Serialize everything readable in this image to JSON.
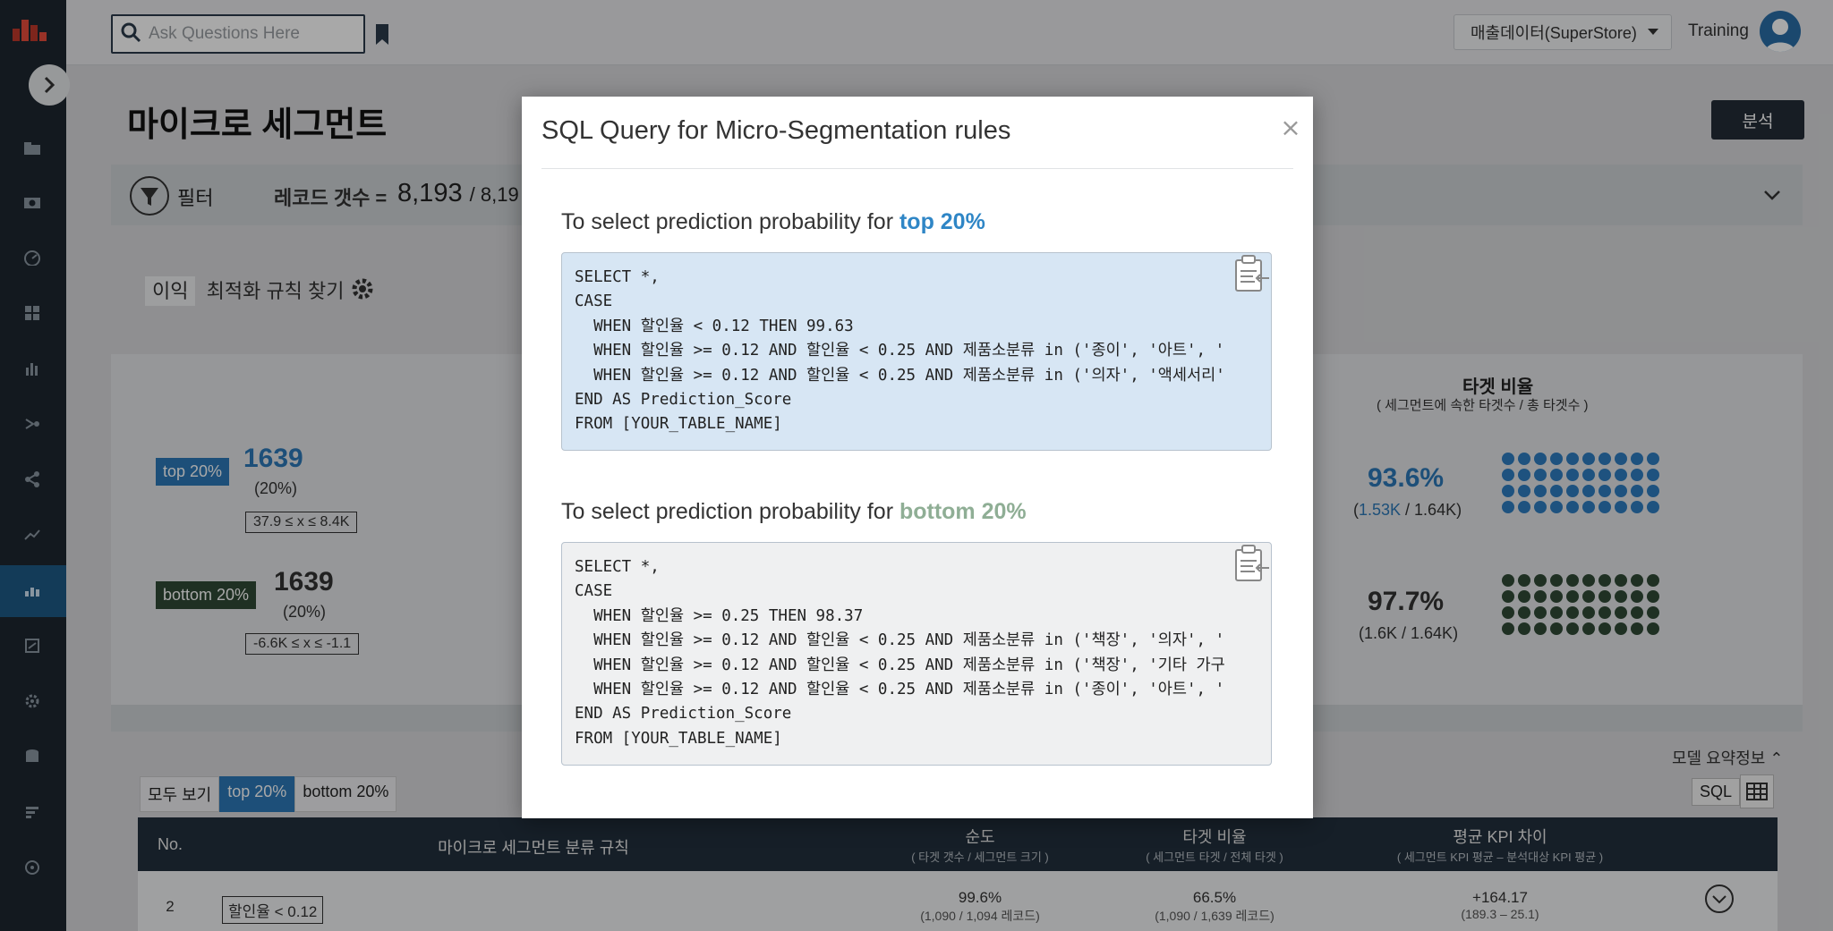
{
  "app": {
    "search_placeholder": "Ask Questions Here",
    "dataset": "매출데이터(SuperStore)",
    "user": "Training"
  },
  "page": {
    "title": "마이크로 세그먼트",
    "analyze_button": "분석",
    "filter_label": "필터",
    "record_label": "레코드 갯수 =",
    "record_count": "8,193",
    "record_total": "/ 8,19",
    "target_kpi": "이익",
    "optimize_label": "최적화 규칙 찾기"
  },
  "segments": {
    "top": {
      "tag": "top 20%",
      "count": "1639",
      "pct": "(20%)",
      "range": "37.9   ≤ x ≤  8.4K"
    },
    "bottom": {
      "tag": "bottom 20%",
      "count": "1639",
      "pct": "(20%)",
      "range": "-6.6K  ≤ x ≤   -1.1"
    }
  },
  "target_ratio": {
    "title": "타겟 비율",
    "subtitle": "( 세그먼트에 속한 타겟수 / 총 타겟수 )",
    "top_pct": "93.6%",
    "top_detail_a": "1.53K",
    "top_detail_b": " / 1.64K)",
    "top_detail_open": "(",
    "bottom_pct": "97.7%",
    "bottom_detail": "(1.6K / 1.64K)"
  },
  "table": {
    "model_summary": "모델 요약정보",
    "tabs": [
      "모두 보기",
      "top 20%",
      "bottom 20%"
    ],
    "sql_button": "SQL",
    "headers": {
      "no": "No.",
      "rule": "마이크로 세그먼트 분류 규칙",
      "purity": "순도",
      "purity_sub": "( 타겟 갯수 / 세그먼트 크기 )",
      "target_ratio": "타겟 비율",
      "target_ratio_sub": "( 세그먼트 타겟 / 전체 타겟 )",
      "kpi": "평균 KPI 차이",
      "kpi_sub": "( 세그먼트 KPI 평균 – 분석대상 KPI 평균 )"
    },
    "rows": [
      {
        "no": "2",
        "rule": "할인율 < 0.12",
        "purity": "99.6%",
        "purity_sub": "(1,090 / 1,094 레코드)",
        "ratio": "66.5%",
        "ratio_sub": "(1,090 / 1,639 레코드)",
        "kpi": "+164.17",
        "kpi_sub": "(189.3 – 25.1)"
      }
    ]
  },
  "modal": {
    "title": "SQL Query for Micro-Segmentation rules",
    "close": "×",
    "top_section_prefix": "To select prediction probability for ",
    "top_section_highlight": "top 20%",
    "bottom_section_prefix": "To select prediction probability for ",
    "bottom_section_highlight": "bottom 20%",
    "top_sql": "SELECT *,\nCASE\n  WHEN 할인율 < 0.12 THEN 99.63\n  WHEN 할인율 >= 0.12 AND 할인율 < 0.25 AND 제품소분류 in ('종이', '아트', '\n  WHEN 할인율 >= 0.12 AND 할인율 < 0.25 AND 제품소분류 in ('의자', '액세서리'\nEND AS Prediction_Score\nFROM [YOUR_TABLE_NAME]",
    "bottom_sql": "SELECT *,\nCASE\n  WHEN 할인율 >= 0.25 THEN 98.37\n  WHEN 할인율 >= 0.12 AND 할인율 < 0.25 AND 제품소분류 in ('책장', '의자', '\n  WHEN 할인율 >= 0.12 AND 할인율 < 0.25 AND 제품소분류 in ('책장', '기타 가구\n  WHEN 할인율 >= 0.12 AND 할인율 < 0.25 AND 제품소분류 in ('종이', '아트', '\nEND AS Prediction_Score\nFROM [YOUR_TABLE_NAME]",
    "top_box_color": "#d7e6f4",
    "bottom_box_color": "#eff0f1"
  },
  "colors": {
    "accent_blue": "#2f86c6",
    "muted_green": "#8fae95",
    "dark_green": "#2f4a36",
    "dot_blue": "#2e7dc1"
  }
}
